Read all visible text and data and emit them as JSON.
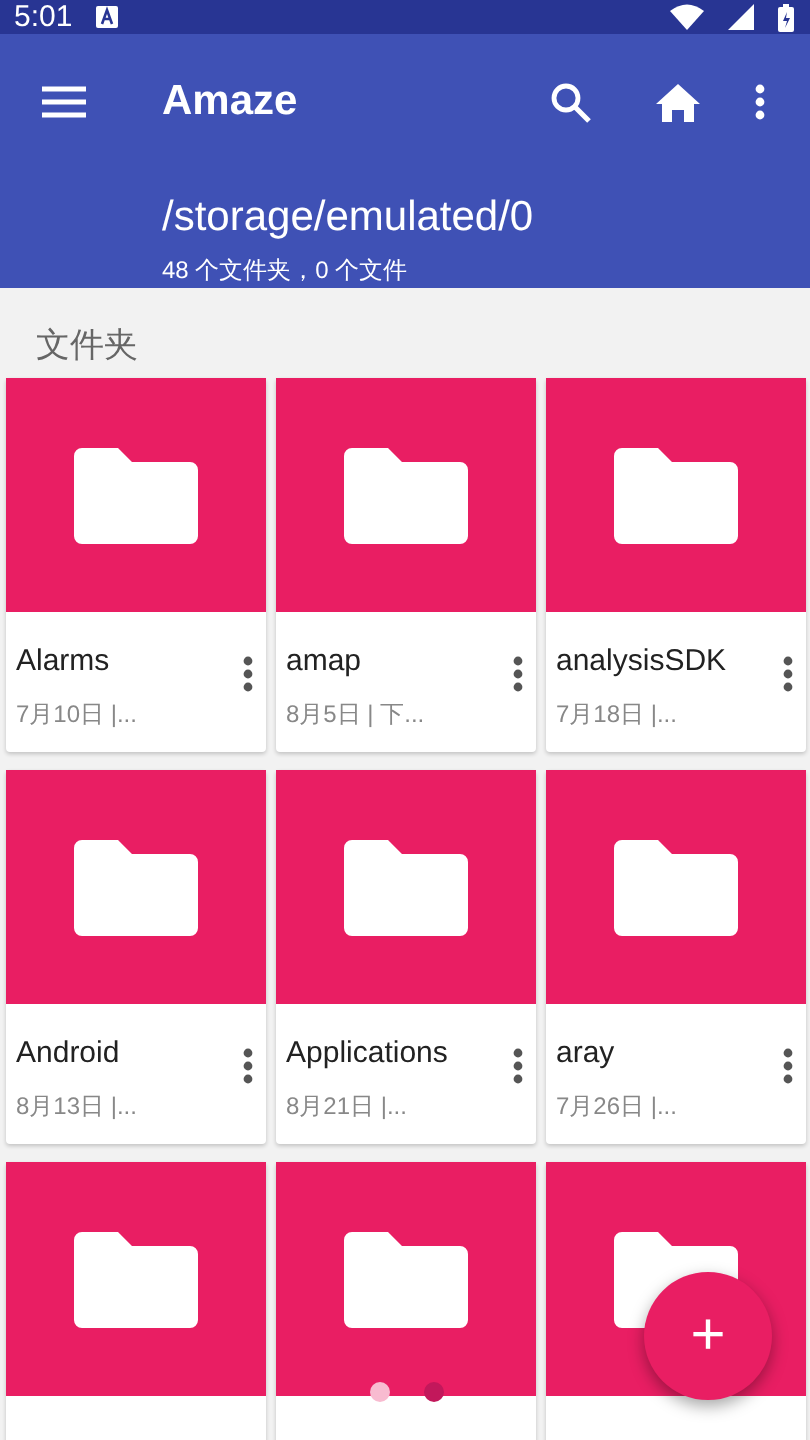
{
  "status_bar": {
    "time": "5:01"
  },
  "app_bar": {
    "title": "Amaze",
    "path": "/storage/emulated/0",
    "summary": "48 个文件夹，0 个文件"
  },
  "section": {
    "title": "文件夹"
  },
  "folders": [
    {
      "kind": "card",
      "name": "Alarms",
      "meta": "7月10日 |..."
    },
    {
      "kind": "card",
      "name": "amap",
      "meta": "8月5日 | 下..."
    },
    {
      "kind": "card",
      "name": "analysisSDK",
      "meta": "7月18日 |..."
    },
    {
      "kind": "card",
      "name": "Android",
      "meta": "8月13日 |..."
    },
    {
      "kind": "card",
      "name": "Applications",
      "meta": "8月21日 |..."
    },
    {
      "kind": "card",
      "name": "aray",
      "meta": "7月26日 |..."
    },
    {
      "kind": "thumbnail"
    },
    {
      "kind": "thumbnail"
    },
    {
      "kind": "thumbnail"
    }
  ],
  "page_indicator": [
    {
      "selected": false
    },
    {
      "selected": true
    }
  ],
  "fab": {
    "label": "+"
  }
}
